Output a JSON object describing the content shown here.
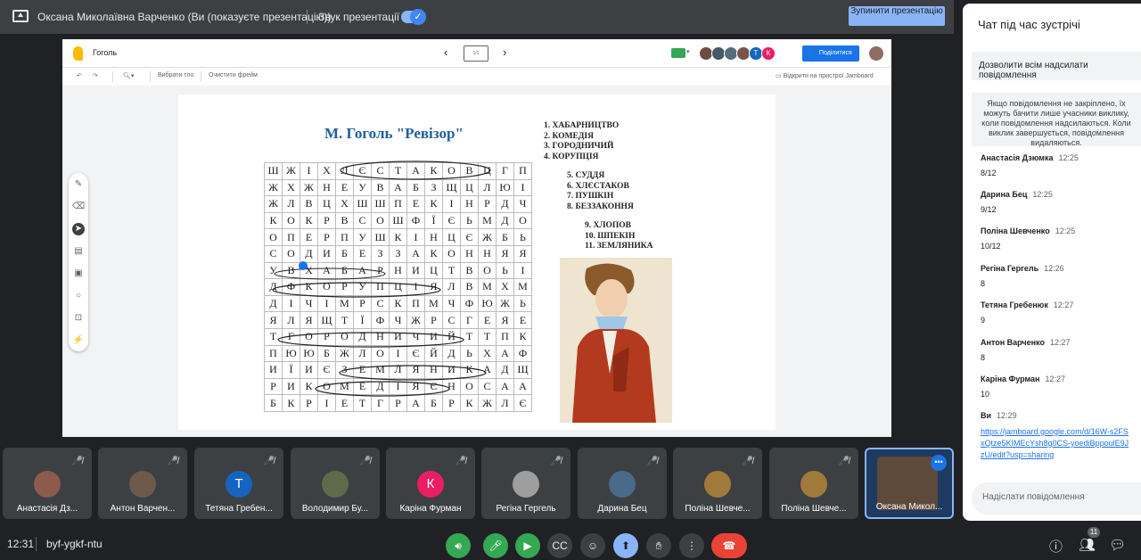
{
  "topbar": {
    "presenter_title": "Оксана Миколаївна Варченко (Ви (показуєте презентацію))",
    "sound_label": "Звук презентації",
    "stop_button": "Зупинити презентацію"
  },
  "jamboard": {
    "title": "Гоголь",
    "toolbar": {
      "select_bg": "Вибрати тло",
      "clear_frame": "Очистити фрейм",
      "open_on_device": "Відкрити на пристрої Jamboard"
    },
    "frame_label": "1/1",
    "share_button": "Поділитися",
    "collaborators": [
      {
        "letter": "",
        "color": "#6d4c41"
      },
      {
        "letter": "",
        "color": "#455a64"
      },
      {
        "letter": "",
        "color": "#546e7a"
      },
      {
        "letter": "",
        "color": "#795548"
      },
      {
        "letter": "Т",
        "color": "#1565c0"
      },
      {
        "letter": "К",
        "color": "#e91e63"
      }
    ],
    "worksheet": {
      "title": "М. Гоголь \"Ревізор\"",
      "grid": [
        [
          "Ш",
          "Ж",
          "І",
          "Х",
          "Л",
          "Є",
          "С",
          "Т",
          "А",
          "К",
          "О",
          "В",
          "Ц",
          "Г",
          "П"
        ],
        [
          "Ж",
          "Х",
          "Ж",
          "Н",
          "Е",
          "У",
          "В",
          "А",
          "Б",
          "З",
          "Щ",
          "Ц",
          "Л",
          "Ю",
          "І"
        ],
        [
          "Ж",
          "Л",
          "В",
          "Ц",
          "Х",
          "Ш",
          "Ш",
          "П",
          "Е",
          "К",
          "І",
          "Н",
          "Р",
          "Д",
          "Ч"
        ],
        [
          "К",
          "О",
          "К",
          "Р",
          "В",
          "С",
          "О",
          "Ш",
          "Ф",
          "Ї",
          "Є",
          "Ь",
          "М",
          "Д",
          "О"
        ],
        [
          "О",
          "П",
          "Е",
          "Р",
          "П",
          "У",
          "Ш",
          "К",
          "І",
          "Н",
          "Ц",
          "Є",
          "Ж",
          "Б",
          "Ь"
        ],
        [
          "С",
          "О",
          "Д",
          "И",
          "Б",
          "Е",
          "З",
          "З",
          "А",
          "К",
          "О",
          "Н",
          "Н",
          "Я",
          "Я"
        ],
        [
          "У",
          "В",
          "Х",
          "А",
          "Б",
          "А",
          "Р",
          "Н",
          "И",
          "Ц",
          "Т",
          "В",
          "О",
          "Ь",
          "І"
        ],
        [
          "Д",
          "Ф",
          "К",
          "О",
          "Р",
          "У",
          "П",
          "Ц",
          "І",
          "Я",
          "Л",
          "В",
          "М",
          "Х",
          "М"
        ],
        [
          "Д",
          "І",
          "Ч",
          "І",
          "М",
          "Р",
          "С",
          "К",
          "П",
          "М",
          "Ч",
          "Ф",
          "Ю",
          "Ж",
          "Ь"
        ],
        [
          "Я",
          "Л",
          "Я",
          "Щ",
          "Т",
          "Ї",
          "Ф",
          "Ч",
          "Ж",
          "Р",
          "С",
          "Г",
          "Е",
          "Я",
          "Е"
        ],
        [
          "Т",
          "Г",
          "О",
          "Р",
          "О",
          "Д",
          "Н",
          "И",
          "Ч",
          "И",
          "Й",
          "Т",
          "Т",
          "П",
          "К"
        ],
        [
          "П",
          "Ю",
          "Ю",
          "Б",
          "Ж",
          "Л",
          "О",
          "І",
          "Є",
          "Й",
          "Д",
          "Ь",
          "Х",
          "А",
          "Ф"
        ],
        [
          "И",
          "Ї",
          "И",
          "Є",
          "З",
          "Е",
          "М",
          "Л",
          "Я",
          "Н",
          "И",
          "К",
          "А",
          "Д",
          "Щ"
        ],
        [
          "Р",
          "И",
          "К",
          "О",
          "М",
          "Е",
          "Д",
          "І",
          "Я",
          "Є",
          "Н",
          "О",
          "С",
          "А",
          "А"
        ],
        [
          "Б",
          "К",
          "Р",
          "І",
          "Е",
          "Т",
          "Г",
          "Р",
          "А",
          "Б",
          "Р",
          "К",
          "Ж",
          "Л",
          "Є"
        ]
      ],
      "words_1": [
        "1. ХАБАРНИЦТВО",
        "2. КОМЕДІЯ",
        "3. ГОРОДНИЧИЙ",
        "4. КОРУПЦІЯ"
      ],
      "words_2": [
        "5. СУДДЯ",
        "6. ХЛЄСТАКОВ",
        "7. ПУШКІН",
        "8. БЕЗЗАКОННЯ"
      ],
      "words_3": [
        "9. ХЛОПОВ",
        "10. ШПЕКІН",
        "11. ЗЕМЛЯНИКА"
      ]
    }
  },
  "participants": [
    {
      "name": "Анастасія Дз...",
      "avatar_color": "#8d5b4c",
      "letter": ""
    },
    {
      "name": "Антон Варчен...",
      "avatar_color": "#6d5a4a",
      "letter": ""
    },
    {
      "name": "Тетяна Гребен...",
      "avatar_color": "#1565c0",
      "letter": "Т"
    },
    {
      "name": "Володимир Бу...",
      "avatar_color": "#5d6b4a",
      "letter": ""
    },
    {
      "name": "Каріна Фурман",
      "avatar_color": "#e91e63",
      "letter": "К"
    },
    {
      "name": "Регіна Гергель",
      "avatar_color": "#9e9e9e",
      "letter": ""
    },
    {
      "name": "Дарина Бец",
      "avatar_color": "#4a6a8a",
      "letter": ""
    },
    {
      "name": "Поліна Шевче...",
      "avatar_color": "#a07a3a",
      "letter": ""
    },
    {
      "name": "Поліна Шевче...",
      "avatar_color": "#a07a3a",
      "letter": ""
    },
    {
      "name": "Оксана Микол...",
      "avatar_color": "#5d4a3a",
      "letter": ""
    }
  ],
  "bottombar": {
    "time": "12:31",
    "meeting_code": "byf-ygkf-ntu",
    "participant_count": "11"
  },
  "chat": {
    "title": "Чат під час зустрічі",
    "allow_all": "Дозволити всім надсилати повідомлення",
    "info": "Якщо повідомлення не закріплено, їх можуть бачити лише учасники виклику, коли повідомлення надсилаються. Коли виклик завершується, повідомлення видаляються.",
    "messages": [
      {
        "name": "Анастасія Дзюмка",
        "time": "12:25",
        "text": "8/12"
      },
      {
        "name": "Дарина Бец",
        "time": "12:25",
        "text": "9/12"
      },
      {
        "name": "Поліна Шевченко",
        "time": "12:25",
        "text": "10/12"
      },
      {
        "name": "Регіна Гергель",
        "time": "12:26",
        "text": "8"
      },
      {
        "name": "Тетяна Гребенюк",
        "time": "12:27",
        "text": "9"
      },
      {
        "name": "Антон Варченко",
        "time": "12:27",
        "text": "8"
      },
      {
        "name": "Каріна Фурман",
        "time": "12:27",
        "text": "10"
      },
      {
        "name": "Ви",
        "time": "12:29",
        "text": "https://jamboard.google.com/d/16W-s2FSxQtze5KIMEcYsh8g0CS-yoediBppoulE9JzU/edit?usp=sharing"
      }
    ],
    "input_placeholder": "Надіслати повідомлення"
  },
  "colors": {
    "accent": "#8ab4f8",
    "primary": "#1a73e8",
    "end_call": "#ea4335",
    "mic_on": "#34a853"
  }
}
